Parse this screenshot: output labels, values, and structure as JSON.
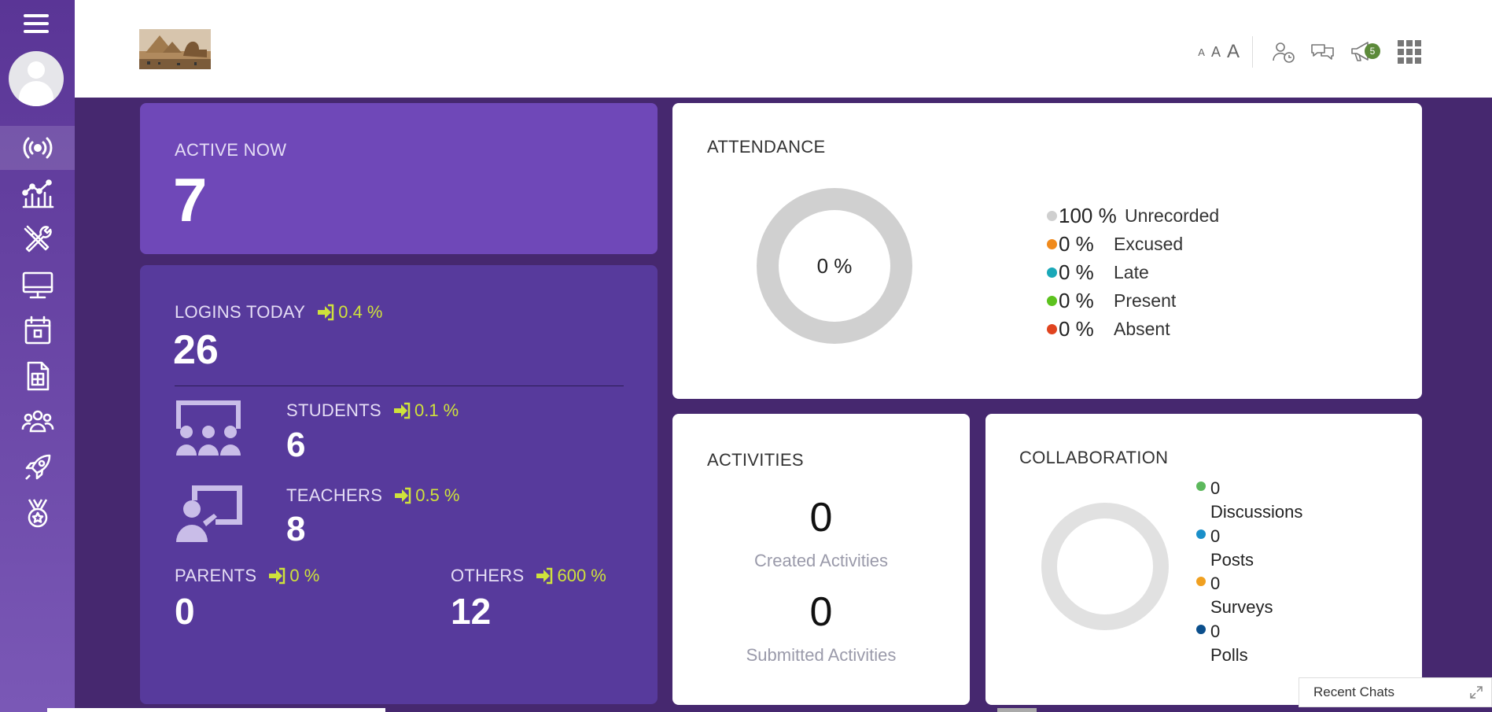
{
  "header": {
    "font_sizes": [
      "A",
      "A",
      "A"
    ],
    "notification_count": "5"
  },
  "sidebar": {
    "icons": [
      "broadcast-icon",
      "analytics-icon",
      "tools-icon",
      "monitor-icon",
      "calendar-icon",
      "spreadsheet-icon",
      "users-icon",
      "rocket-icon",
      "medal-icon"
    ]
  },
  "active_now": {
    "label": "ACTIVE NOW",
    "value": "7"
  },
  "logins_today": {
    "label": "LOGINS TODAY",
    "pct": "0.4 %",
    "value": "26",
    "students": {
      "label": "STUDENTS",
      "pct": "0.1 %",
      "value": "6"
    },
    "teachers": {
      "label": "TEACHERS",
      "pct": "0.5 %",
      "value": "8"
    },
    "parents": {
      "label": "PARENTS",
      "pct": "0 %",
      "value": "0"
    },
    "others": {
      "label": "OTHERS",
      "pct": "600 %",
      "value": "12"
    }
  },
  "attendance": {
    "title": "ATTENDANCE",
    "center": "0 %",
    "legend": [
      {
        "value": "100 %",
        "label": "Unrecorded",
        "color": "#cfcfcf"
      },
      {
        "value": "0 %",
        "label": "Excused",
        "color": "#f08a1c"
      },
      {
        "value": "0 %",
        "label": "Late",
        "color": "#1aa8b8"
      },
      {
        "value": "0 %",
        "label": "Present",
        "color": "#5cc21e"
      },
      {
        "value": "0 %",
        "label": "Absent",
        "color": "#e0441f"
      }
    ]
  },
  "activities": {
    "title": "ACTIVITIES",
    "created_value": "0",
    "created_label": "Created Activities",
    "submitted_value": "0",
    "submitted_label": "Submitted Activities"
  },
  "collaboration": {
    "title": "COLLABORATION",
    "items": [
      {
        "value": "0",
        "label": "Discussions",
        "color": "#5cb85c"
      },
      {
        "value": "0",
        "label": "Posts",
        "color": "#1a8fc9"
      },
      {
        "value": "0",
        "label": "Surveys",
        "color": "#f0a020"
      },
      {
        "value": "0",
        "label": "Polls",
        "color": "#0b4f8c"
      }
    ]
  },
  "recent_chats": {
    "label": "Recent Chats"
  }
}
